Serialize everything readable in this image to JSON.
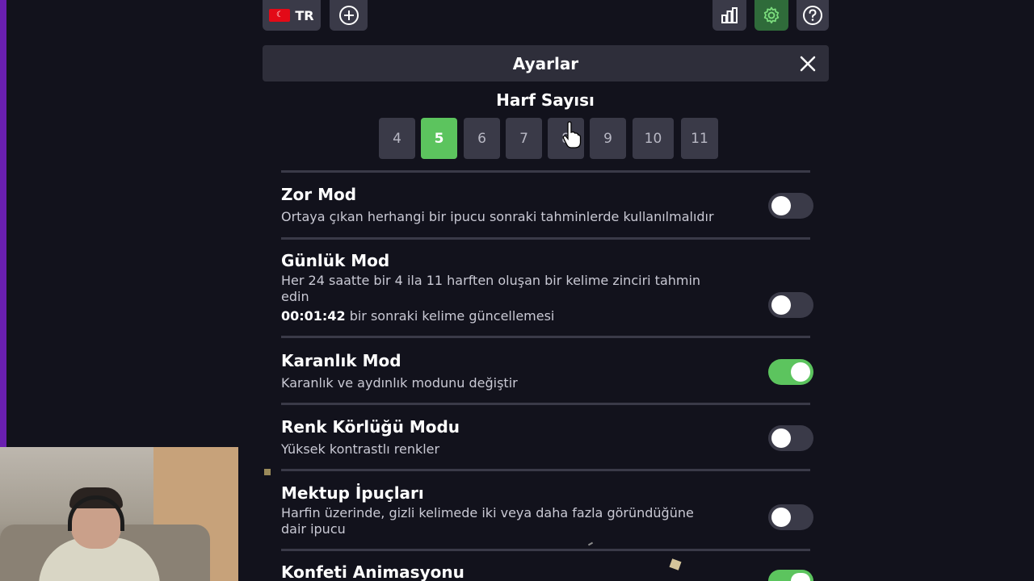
{
  "topbar": {
    "language_code": "TR",
    "flag_icon": "turkey-flag-icon",
    "add_icon": "plus-circle-icon",
    "stats_icon": "bar-chart-icon",
    "settings_icon": "gear-icon",
    "help_icon": "question-circle-icon"
  },
  "panel": {
    "title": "Ayarlar",
    "close_icon": "close-icon"
  },
  "letter_count": {
    "title": "Harf Sayısı",
    "options": [
      "4",
      "5",
      "6",
      "7",
      "8",
      "9",
      "10",
      "11"
    ],
    "selected": "5"
  },
  "settings": [
    {
      "title": "Zor Mod",
      "desc": "Ortaya çıkan herhangi bir ipucu sonraki tahminlerde kullanılmalıdır",
      "enabled": false
    },
    {
      "title": "Günlük Mod",
      "desc": "Her 24 saatte bir 4 ila 11 harften oluşan bir kelime zinciri tahmin edin",
      "timer": "00:01:42",
      "timer_suffix": "bir sonraki kelime güncellemesi",
      "enabled": false
    },
    {
      "title": "Karanlık Mod",
      "desc": "Karanlık ve aydınlık modunu değiştir",
      "enabled": true
    },
    {
      "title": "Renk Körlüğü Modu",
      "desc": "Yüksek kontrastlı renkler",
      "enabled": false
    },
    {
      "title": "Mektup İpuçları",
      "desc": "Harfin üzerinde, gizli kelimede iki veya daha fazla göründüğüne dair ipucu",
      "enabled": false
    },
    {
      "title": "Konfeti Animasyonu",
      "enabled": true
    }
  ],
  "colors": {
    "background": "#12121c",
    "panel": "#2e2e3a",
    "button": "#3a3a48",
    "accent_green": "#5cc45e",
    "stripe_purple": "#6a1fb0"
  }
}
